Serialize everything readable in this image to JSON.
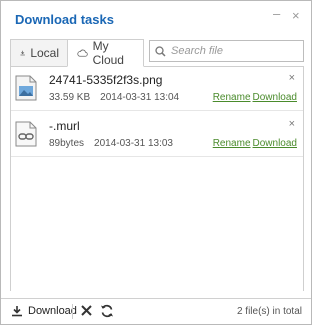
{
  "window": {
    "title": "Download tasks",
    "minimize_glyph": "–",
    "close_glyph": "×"
  },
  "tabs": [
    {
      "label": "Local",
      "icon": "download-icon",
      "active": false
    },
    {
      "label": "My Cloud",
      "icon": "cloud-icon",
      "active": true
    }
  ],
  "search": {
    "placeholder": "Search file",
    "value": ""
  },
  "files": [
    {
      "name": "24741-5335f2f3s.png",
      "size": "33.59 KB",
      "date": "2014-03-31 13:04",
      "icon": "image-file-icon",
      "rename_label": "Rename",
      "download_label": "Download",
      "remove_glyph": "×"
    },
    {
      "name": "-.murl",
      "size": "89bytes",
      "date": "2014-03-31 13:03",
      "icon": "link-file-icon",
      "rename_label": "Rename",
      "download_label": "Download",
      "remove_glyph": "×"
    }
  ],
  "statusbar": {
    "download_label": "Download",
    "total_text": "2 file(s) in total"
  },
  "colors": {
    "title": "#1a67b5",
    "action_link": "#4a8b2c",
    "border": "#cfcfcf"
  }
}
